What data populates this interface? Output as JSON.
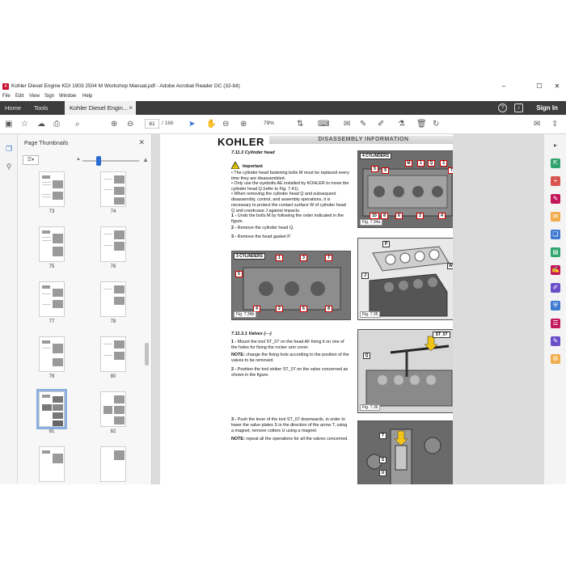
{
  "window": {
    "title": "Kohler Diesel Engine KDI 1903 2504 M Workshop Manual.pdf - Adobe Acrobat Reader DC (32-bit)",
    "minimize": "–",
    "maximize": "☐",
    "close": "✕"
  },
  "menu": [
    "File",
    "Edit",
    "View",
    "Sign",
    "Window",
    "Help"
  ],
  "tabs": {
    "home": "Home",
    "tools": "Tools",
    "document": "Kohler Diesel Engin...",
    "close": "×",
    "sign_in": "Sign In"
  },
  "toolbar": {
    "current_page": "81",
    "total_pages": "/ 166",
    "zoom": "79%"
  },
  "thumbnails_panel": {
    "title": "Page Thumbnails",
    "pages": [
      "73",
      "74",
      "75",
      "76",
      "77",
      "78",
      "79",
      "80",
      "81",
      "82"
    ],
    "selected": "81"
  },
  "doc": {
    "brand": "KOHLER",
    "section_title": "DISASSEMBLY INFORMATION",
    "section_number": "7",
    "heading_1": "7.11.3  Cylinder head",
    "important_label": "Important",
    "bullets": [
      "The cylinder head fastening bolts M must be replaced every time they are disassembled.",
      "Only use the eyebolts AE installed by KOHLER to move the cylinder head Q (refer to Fig. 7.41).",
      "When removing the cylinder head Q and subsequent disassembly, control, and assembly operations, it is necessary to protect the contact surface W of cylinder head Q and crankcase J against impacts."
    ],
    "steps_a": [
      {
        "n": "1 -",
        "text": "Undo the bolts M by following the order indicated in the figure."
      },
      {
        "n": "2 -",
        "text": "Remove the cylinder head Q."
      },
      {
        "n": "3 -",
        "text": "Remove the head gasket P."
      }
    ],
    "heading_2": "7.11.3.1  Valves (---)",
    "steps_b": [
      {
        "n": "1 -",
        "text": "Mount the tool ST_07 on the head AF fixing it on one of the holes for fixing the rocker arm cover."
      },
      {
        "n": "NOTE:",
        "text": "change the fixing hole according to the position of the valves to be removed."
      },
      {
        "n": "2 -",
        "text": "Position the tool striker ST_07 on the valve concerned as shown in the figure."
      }
    ],
    "steps_c": [
      {
        "n": "3 -",
        "text": "Push the lever of the tool ST_07 downwards, in order to lower the valve plates S in the direction of the arrow T, using a magnet, remove cotters U using a magnet."
      },
      {
        "n": "NOTE:",
        "text": "repeat all the operations for all the valves concerned."
      }
    ],
    "figures": {
      "fig_734a_header": "4 CYLINDERS",
      "fig_734a_caption": "Fig. 7.34a",
      "fig_734a_tags": [
        "M",
        "1",
        "Q",
        "3",
        "5",
        "9",
        "10",
        "2",
        "6",
        "8",
        "7",
        "4"
      ],
      "fig_734b_header": "3 CYLINDERS",
      "fig_734b_caption": "Fig. 7.34b",
      "fig_734b_tags": [
        "1",
        "3",
        "7",
        "5",
        "4",
        "2",
        "6",
        "8"
      ],
      "fig_735_caption": "Fig. 7.35",
      "fig_735_tags": [
        "P",
        "W",
        "J"
      ],
      "fig_736_caption": "Fig. 7.36",
      "fig_736_tags": [
        "ST_07",
        "Q"
      ],
      "fig_737_tags": [
        "T",
        "S",
        "U"
      ]
    }
  }
}
